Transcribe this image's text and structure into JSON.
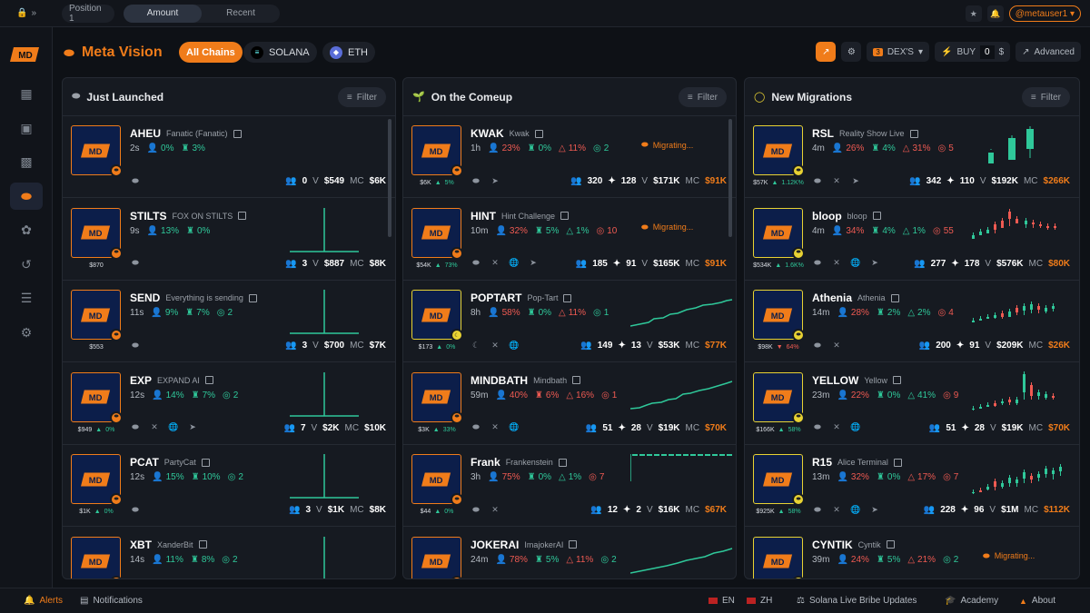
{
  "topbar": {
    "tabs": [
      "Position 1",
      "Amount",
      "Recent"
    ],
    "user": "@metauser1"
  },
  "header": {
    "title": "Meta Vision",
    "chains": [
      "All Chains",
      "SOLANA",
      "ETH"
    ],
    "dex": "DEX'S",
    "dex_count": "3",
    "buy": "BUY",
    "amount": "0",
    "currency": "$",
    "advanced": "Advanced"
  },
  "columns": [
    {
      "title": "Just Launched",
      "filter": "Filter",
      "rows": [
        {
          "sym": "AHEU",
          "name": "Fanatic (Fanatic)",
          "age": "2s",
          "s1": "0%",
          "s2": "3%",
          "s3": "",
          "under": "",
          "holders": "0",
          "vol": "$549",
          "mc": "$6K",
          "icons": [
            "pill"
          ],
          "spark": "none"
        },
        {
          "sym": "STILTS",
          "name": "FOX ON STILTS",
          "age": "9s",
          "s1": "13%",
          "s2": "0%",
          "s3": "",
          "under": "$870",
          "holders": "3",
          "vol": "$887",
          "mc": "$8K",
          "icons": [
            "pill"
          ],
          "spark": "spike"
        },
        {
          "sym": "SEND",
          "name": "Everything is sending",
          "age": "11s",
          "s1": "9%",
          "s2": "7%",
          "s3": "2",
          "under": "$553",
          "holders": "3",
          "vol": "$700",
          "mc": "$7K",
          "icons": [
            "pill"
          ],
          "spark": "spike"
        },
        {
          "sym": "EXP",
          "name": "EXPAND AI",
          "age": "12s",
          "s1": "14%",
          "s2": "7%",
          "s3": "2",
          "under": "$949",
          "upct": "0%",
          "holders": "7",
          "vol": "$2K",
          "mc": "$10K",
          "icons": [
            "pill",
            "x",
            "globe",
            "tg"
          ],
          "spark": "spike"
        },
        {
          "sym": "PCAT",
          "name": "PartyCat",
          "age": "12s",
          "s1": "15%",
          "s2": "10%",
          "s3": "2",
          "under": "$1K",
          "upct": "0%",
          "holders": "3",
          "vol": "$1K",
          "mc": "$8K",
          "icons": [
            "pill"
          ],
          "spark": "spike"
        },
        {
          "sym": "XBT",
          "name": "XanderBit",
          "age": "14s",
          "s1": "11%",
          "s2": "8%",
          "s3": "2",
          "under": "",
          "holders": "",
          "vol": "",
          "mc": "",
          "icons": [],
          "spark": "spike"
        }
      ]
    },
    {
      "title": "On the Comeup",
      "filter": "Filter",
      "rows": [
        {
          "sym": "KWAK",
          "name": "Kwak",
          "age": "1h",
          "s1": "23%",
          "s2": "0%",
          "s3": "11%",
          "s4": "2",
          "under": "$6K",
          "upct": "5%",
          "holders": "320",
          "bots": "128",
          "vol": "$171K",
          "mc": "$91K",
          "icons": [
            "pill",
            "tg"
          ],
          "migr": "Migrating...",
          "spark": "none"
        },
        {
          "sym": "HINT",
          "name": "Hint Challenge",
          "age": "10m",
          "s1": "32%",
          "s2": "5%",
          "s3": "1%",
          "s4": "10",
          "under": "$54K",
          "upct": "73%",
          "holders": "185",
          "bots": "91",
          "vol": "$165K",
          "mc": "$91K",
          "icons": [
            "pill",
            "x",
            "globe",
            "tg"
          ],
          "migr": "Migrating...",
          "spark": "none"
        },
        {
          "sym": "POPTART",
          "name": "Pop-Tart",
          "age": "8h",
          "s1": "58%",
          "s2": "0%",
          "s3": "11%",
          "s4": "1",
          "under": "$173",
          "upct": "0%",
          "holders": "149",
          "bots": "13",
          "vol": "$53K",
          "mc": "$77K",
          "icons": [
            "moon",
            "x",
            "globe"
          ],
          "spark": "line1"
        },
        {
          "sym": "MINDBATH",
          "name": "Mindbath",
          "age": "59m",
          "s1": "40%",
          "s2": "6%",
          "s3": "16%",
          "s4": "1",
          "under": "$3K",
          "upct": "33%",
          "holders": "51",
          "bots": "28",
          "vol": "$19K",
          "mc": "$70K",
          "icons": [
            "pill",
            "x",
            "globe"
          ],
          "spark": "line2"
        },
        {
          "sym": "Frank",
          "name": "Frankenstein",
          "age": "3h",
          "s1": "75%",
          "s2": "0%",
          "s3": "1%",
          "s4": "7",
          "under": "$44",
          "upct": "0%",
          "holders": "12",
          "bots": "2",
          "vol": "$16K",
          "mc": "$67K",
          "icons": [
            "pill",
            "x"
          ],
          "spark": "flat"
        },
        {
          "sym": "JOKERAI",
          "name": "ImajokerAI",
          "age": "24m",
          "s1": "78%",
          "s2": "5%",
          "s3": "11%",
          "s4": "2",
          "under": "",
          "holders": "",
          "bots": "",
          "vol": "",
          "mc": "",
          "icons": [],
          "spark": "line3"
        }
      ]
    },
    {
      "title": "New Migrations",
      "filter": "Filter",
      "rows": [
        {
          "sym": "RSL",
          "name": "Reality Show Live",
          "age": "4m",
          "s1": "26%",
          "s2": "4%",
          "s3": "31%",
          "s4": "5",
          "under": "$57K",
          "upct": "1.12K%",
          "holders": "342",
          "bots": "110",
          "vol": "$192K",
          "mc": "$266K",
          "icons": [
            "pill",
            "x",
            "tg"
          ],
          "spark": "candles1"
        },
        {
          "sym": "bloop",
          "name": "bloop",
          "age": "4m",
          "s1": "34%",
          "s2": "4%",
          "s3": "1%",
          "s4": "55",
          "under": "$534K",
          "upct": "1.6K%",
          "holders": "277",
          "bots": "178",
          "vol": "$576K",
          "mc": "$80K",
          "icons": [
            "pill",
            "x",
            "globe",
            "tg"
          ],
          "spark": "candles2"
        },
        {
          "sym": "Athenia",
          "name": "Athenia",
          "age": "14m",
          "s1": "28%",
          "s2": "2%",
          "s3": "2%",
          "s4": "4",
          "under": "$98K",
          "upct": "64%",
          "udown": true,
          "holders": "200",
          "bots": "91",
          "vol": "$209K",
          "mc": "$26K",
          "icons": [
            "pill",
            "x"
          ],
          "spark": "candles3"
        },
        {
          "sym": "YELLOW",
          "name": "Yellow",
          "age": "23m",
          "s1": "22%",
          "s2": "0%",
          "s3": "41%",
          "s4": "9",
          "under": "$166K",
          "upct": "58%",
          "holders": "51",
          "bots": "28",
          "vol": "$19K",
          "mc": "$70K",
          "icons": [
            "pill",
            "x",
            "globe"
          ],
          "spark": "candles4"
        },
        {
          "sym": "R15",
          "name": "Alice Terminal",
          "age": "13m",
          "s1": "32%",
          "s2": "0%",
          "s3": "17%",
          "s4": "7",
          "under": "$925K",
          "upct": "58%",
          "holders": "228",
          "bots": "96",
          "vol": "$1M",
          "mc": "$112K",
          "icons": [
            "pill",
            "x",
            "globe",
            "tg"
          ],
          "spark": "candles5"
        },
        {
          "sym": "CYNTIK",
          "name": "Cyntik",
          "age": "39m",
          "s1": "24%",
          "s2": "5%",
          "s3": "21%",
          "s4": "2",
          "under": "",
          "holders": "",
          "bots": "",
          "vol": "",
          "mc": "",
          "icons": [],
          "migr": "Migrating...",
          "spark": "none"
        }
      ]
    }
  ],
  "labels": {
    "v": "V",
    "mc": "MC"
  },
  "footer": {
    "alerts": "Alerts",
    "notifications": "Notifications",
    "en": "EN",
    "zh": "ZH",
    "bribe": "Solana Live Bribe Updates",
    "academy": "Academy",
    "about": "About"
  }
}
